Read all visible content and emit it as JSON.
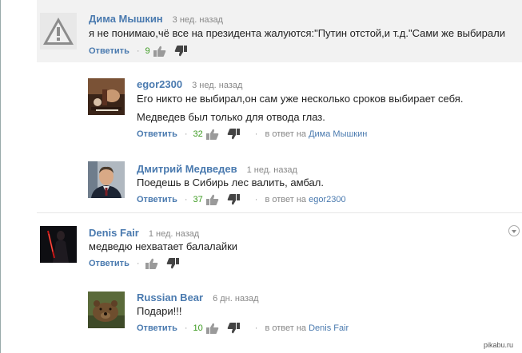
{
  "comments": [
    {
      "author": "Дима Мышкин",
      "time": "3 нед. назад",
      "text": [
        "я не понимаю,чё все на президента жалуются:\"Путин отстой,и т.д.\"Сами же выбирали"
      ],
      "reply_label": "Ответить",
      "likes": "9",
      "in_reply_prefix": "",
      "in_reply_to": "",
      "avatar_icon": "warning-triangle-icon"
    },
    {
      "author": "egor2300",
      "time": "3 нед. назад",
      "text": [
        "Его никто не выбирал,он сам уже несколько сроков выбирает себя.",
        "Медведев был только для отвода глаз."
      ],
      "reply_label": "Ответить",
      "likes": "32",
      "in_reply_prefix": "в ответ на",
      "in_reply_to": "Дима Мышкин",
      "avatar_icon": "photo-avatar"
    },
    {
      "author": "Дмитрий Медведев",
      "time": "1 нед. назад",
      "text": [
        "Поедешь в Сибирь лес валить, амбал."
      ],
      "reply_label": "Ответить",
      "likes": "37",
      "in_reply_prefix": "в ответ на",
      "in_reply_to": "egor2300",
      "avatar_icon": "portrait-avatar"
    },
    {
      "author": "Denis Fair",
      "time": "1 нед. назад",
      "text": [
        "медведю нехватает балалайки"
      ],
      "reply_label": "Ответить",
      "likes": "",
      "in_reply_prefix": "",
      "in_reply_to": "",
      "avatar_icon": "dark-figure-avatar"
    },
    {
      "author": "Russian Bear",
      "time": "6 дн. назад",
      "text": [
        "Подари!!!"
      ],
      "reply_label": "Ответить",
      "likes": "10",
      "in_reply_prefix": "в ответ на",
      "in_reply_to": "Denis Fair",
      "avatar_icon": "bear-avatar"
    }
  ],
  "watermark": "pikabu.ru",
  "colors": {
    "author": "#4a7aaf",
    "likes": "#3b9a1f",
    "highlight": "#f2f2f2"
  }
}
